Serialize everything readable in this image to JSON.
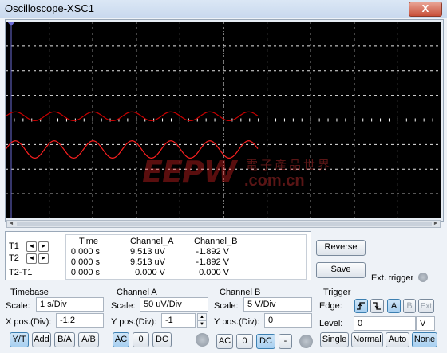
{
  "window": {
    "title": "Oscilloscope-XSC1",
    "close_glyph": "X"
  },
  "colors": {
    "trace_a": "#ff2020",
    "trace_b": "#c80000",
    "grid": "#ffffff",
    "screen_bg": "#000000",
    "cursor_t1": "#6b6bd6"
  },
  "scope": {
    "grid_divisions": {
      "x": 10,
      "y": 8
    },
    "channel_a_waveform": {
      "cycles": 6.5,
      "amplitude_div": 0.35,
      "offset_div": -1.2
    },
    "channel_b_waveform": {
      "cycles": 6.5,
      "amplitude_div": 0.18,
      "offset_div": 0.15
    }
  },
  "readout": {
    "headers": [
      "Time",
      "Channel_A",
      "Channel_B"
    ],
    "rows": [
      {
        "label": "T1",
        "time": "0.000 s",
        "channel_a": "9.513 uV",
        "channel_b": "-1.892 V"
      },
      {
        "label": "T2",
        "time": "0.000 s",
        "channel_a": "9.513 uV",
        "channel_b": "-1.892 V"
      },
      {
        "label": "T2-T1",
        "time": "0.000 s",
        "channel_a": "0.000 V",
        "channel_b": "0.000 V"
      }
    ]
  },
  "buttons": {
    "reverse": "Reverse",
    "save": "Save",
    "ext_trigger": "Ext. trigger"
  },
  "timebase": {
    "title": "Timebase",
    "scale_label": "Scale:",
    "scale_value": "1 s/Div",
    "xpos_label": "X pos.(Div):",
    "xpos_value": "-1.2",
    "modes": [
      "Y/T",
      "Add",
      "B/A",
      "A/B"
    ],
    "active_mode": "Y/T"
  },
  "channel_a": {
    "title": "Channel A",
    "scale_label": "Scale:",
    "scale_value": "50 uV/Div",
    "ypos_label": "Y pos.(Div):",
    "ypos_value": "-1",
    "coupling": [
      "AC",
      "0",
      "DC"
    ],
    "active_coupling": "AC"
  },
  "channel_b": {
    "title": "Channel B",
    "scale_label": "Scale:",
    "scale_value": "5 V/Div",
    "ypos_label": "Y pos.(Div):",
    "ypos_value": "0",
    "coupling": [
      "AC",
      "0",
      "DC",
      "-"
    ],
    "active_coupling": "DC"
  },
  "trigger": {
    "title": "Trigger",
    "edge_label": "Edge:",
    "edge_buttons": [
      "f",
      "t",
      "A",
      "B",
      "Ext"
    ],
    "active_edge": "A",
    "level_label": "Level:",
    "level_value": "0",
    "level_unit": "V",
    "modes": [
      "Single",
      "Normal",
      "Auto",
      "None"
    ],
    "active_mode": "None"
  },
  "watermark": {
    "logo": "EEPW",
    "cn_text": "電子產品世界",
    "url": ".com.cn"
  }
}
